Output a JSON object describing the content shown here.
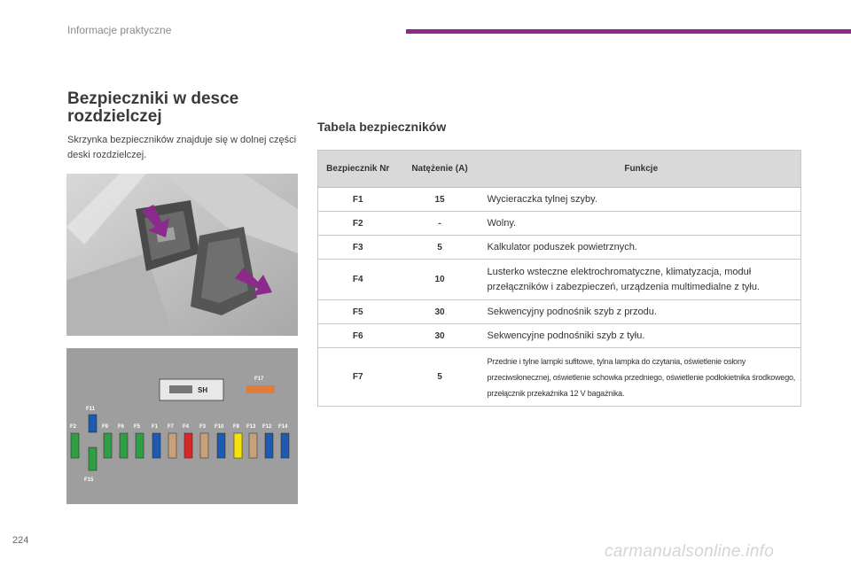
{
  "header": {
    "title": "Informacje praktyczne",
    "accent_color": "#8b2a8b"
  },
  "section": {
    "title": "Bezpieczniki w desce rozdzielczej",
    "intro": "Skrzynka bezpieczników znajduje się w dolnej części deski rozdzielczej."
  },
  "diagram": {
    "relay_label": "SH",
    "fuse_labels_top": [
      "F2",
      "F11",
      "F9",
      "F6",
      "F5",
      "F1",
      "F7",
      "F4",
      "F3",
      "F10",
      "F8",
      "F13",
      "F12",
      "F14"
    ],
    "fuse_label_f17": "F17",
    "fuse_label_f15": "F15"
  },
  "table": {
    "title": "Tabela bezpieczników",
    "headers": {
      "nr": "Bezpiecznik Nr",
      "amp": "Natężenie (A)",
      "fn": "Funkcje"
    },
    "rows": [
      {
        "nr": "F1",
        "amp": "15",
        "fn": "Wycieraczka tylnej szyby."
      },
      {
        "nr": "F2",
        "amp": "-",
        "fn": "Wolny."
      },
      {
        "nr": "F3",
        "amp": "5",
        "fn": "Kalkulator poduszek powietrznych."
      },
      {
        "nr": "F4",
        "amp": "10",
        "fn": "Lusterko wsteczne elektrochromatyczne, klimatyzacja, moduł przełączników i zabezpieczeń, urządzenia multimedialne z tyłu."
      },
      {
        "nr": "F5",
        "amp": "30",
        "fn": "Sekwencyjny podnośnik szyb z przodu."
      },
      {
        "nr": "F6",
        "amp": "30",
        "fn": "Sekwencyjne podnośniki szyb z tyłu."
      },
      {
        "nr": "F7",
        "amp": "5",
        "fn": "Przednie i tylne lampki sufitowe, tylna lampka do czytania, oświetlenie osłony przeciwsłonecznej, oświetlenie schowka przedniego, oświetlenie podłokietnika środkowego, przełącznik przekaźnika 12 V bagażnika."
      }
    ]
  },
  "page_number": "224",
  "watermark": "carmanualsonline.info"
}
